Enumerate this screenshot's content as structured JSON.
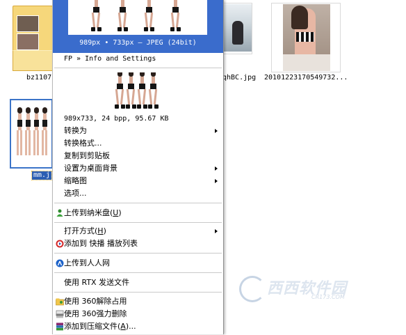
{
  "desktop": {
    "folder_label": "bz1107",
    "file2_label": "qhBC.jpg",
    "file3_label": "20101223170549732...",
    "selected_label": "mm.j"
  },
  "preview": {
    "caption": "989px • 733px — JPEG (24bit)"
  },
  "menu": {
    "header": "FP » Info and Settings",
    "info": "989x733, 24 bpp, 95.67 KB",
    "items": [
      {
        "label": "转换为",
        "submenu": true
      },
      {
        "label": "转换格式...",
        "submenu": false
      },
      {
        "label": "复制到剪贴板",
        "submenu": false
      },
      {
        "label": "设置为桌面背景",
        "submenu": true
      },
      {
        "label": "缩略图",
        "submenu": true
      },
      {
        "label": "选项...",
        "submenu": false
      }
    ],
    "upload_nami": {
      "label": "上传到纳米盘",
      "key": "U"
    },
    "open_with": {
      "label": "打开方式",
      "key": "H"
    },
    "add_kuaibo": "添加到 快播 播放列表",
    "upload_renren": "上传到人人网",
    "rtx": "使用 RTX 发送文件",
    "unlock360": "使用 360解除占用",
    "delete360": "使用 360强力删除",
    "add_archive": {
      "label": "添加到压缩文件",
      "key": "A",
      "suffix": "..."
    }
  },
  "watermark": {
    "text": "西西软件园",
    "sub": "CR173.COM"
  },
  "colors": {
    "selection_blue": "#3a6ccc",
    "menu_bg": "#ffffff"
  },
  "icons": {
    "upload_nami": "person-upload-icon",
    "kuaibo": "play-circle-icon",
    "renren": "renren-logo-icon",
    "unlock360": "folder-unlock-icon",
    "delete360": "shredder-icon",
    "archive": "winrar-stack-icon"
  }
}
